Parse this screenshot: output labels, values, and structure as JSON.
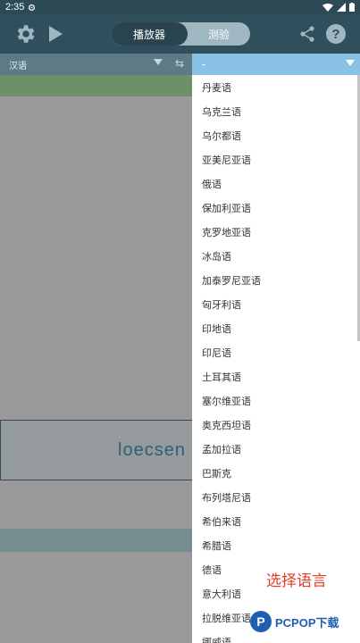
{
  "status_bar": {
    "time": "2:35"
  },
  "app_bar": {
    "toggle": {
      "player_label": "播放器",
      "test_label": "测验"
    }
  },
  "language_row": {
    "source_language": "汉语",
    "target_placeholder": "-"
  },
  "main": {
    "text_preview": "loecsen"
  },
  "dropdown": {
    "items": [
      "丹麦语",
      "乌克兰语",
      "乌尔都语",
      "亚美尼亚语",
      "俄语",
      "保加利亚语",
      "克罗地亚语",
      "冰岛语",
      "加泰罗尼亚语",
      "匈牙利语",
      "印地语",
      "印尼语",
      "土耳其语",
      "塞尔维亚语",
      "奥克西坦语",
      "孟加拉语",
      "巴斯克",
      "布列塔尼语",
      "希伯来语",
      "希腊语",
      "德语",
      "意大利语",
      "拉脱维亚语",
      "挪威语"
    ]
  },
  "annotation": {
    "text": "选择语言"
  },
  "watermark": {
    "brand": "PCPOP下载"
  },
  "colors": {
    "app_bar": "#2f4f5c",
    "dropdown_header": "#89c1e4",
    "annotation": "#e23c2c"
  }
}
